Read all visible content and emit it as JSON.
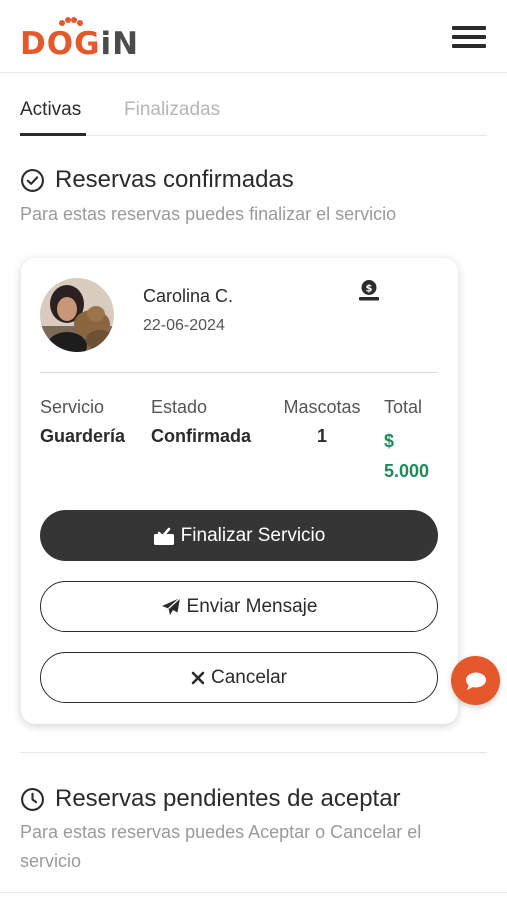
{
  "brand": {
    "logo_prefix": "D",
    "logo_o": "O",
    "logo_g": "G",
    "logo_suffix": "iN",
    "accent_color": "#e4582b"
  },
  "header": {
    "menu_icon": "hamburger-menu-icon"
  },
  "tabs": [
    {
      "label": "Activas",
      "active": true
    },
    {
      "label": "Finalizadas",
      "active": false
    }
  ],
  "confirmed": {
    "title": "Reservas confirmadas",
    "subtitle": "Para estas reservas puedes finalizar el servicio",
    "icon": "check-circle-icon"
  },
  "reservation": {
    "client_name": "Carolina C.",
    "date": "22-06-2024",
    "payment_icon": "money-hand-icon",
    "columns": {
      "service_label": "Servicio",
      "service_value": "Guardería",
      "status_label": "Estado",
      "status_value": "Confirmada",
      "pets_label": "Mascotas",
      "pets_value": "1",
      "total_label": "Total",
      "total_currency": "$",
      "total_value": "5.000",
      "total_color": "#1f8a5a"
    },
    "actions": {
      "finish_label": "Finalizar Servicio",
      "message_label": "Enviar Mensaje",
      "cancel_label": "Cancelar"
    }
  },
  "pending": {
    "title": "Reservas pendientes de aceptar",
    "subtitle": "Para estas reservas puedes Aceptar o Cancelar el servicio",
    "icon": "clock-icon"
  },
  "chat": {
    "icon": "chat-bubble-icon"
  }
}
